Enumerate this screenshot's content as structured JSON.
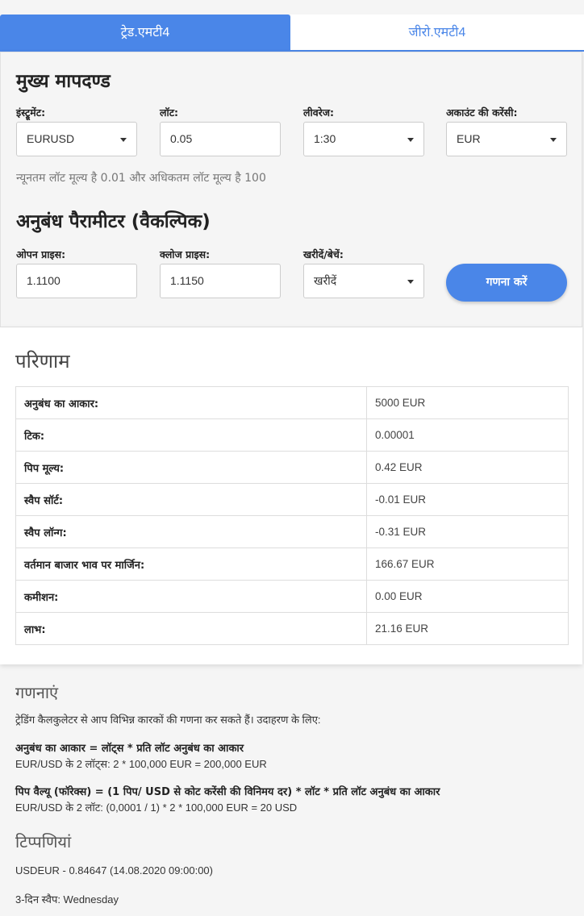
{
  "tabs": {
    "active": "ट्रेड.एमटी4",
    "inactive": "जीरो.एमटी4"
  },
  "main_params": {
    "title": "मुख्य मापदण्ड",
    "instrument": {
      "label": "इंस्ट्रूमेंट:",
      "value": "EURUSD"
    },
    "lot": {
      "label": "लॉट:",
      "value": "0.05"
    },
    "leverage": {
      "label": "लीवरेज:",
      "value": "1:30"
    },
    "currency": {
      "label": "अकाउंट की करेंसी:",
      "value": "EUR"
    },
    "hint": "न्यूनतम लॉट मूल्य है 0.01 और अधिकतम लॉट मूल्य है 100"
  },
  "contract_params": {
    "title": "अनुबंध पैरामीटर (वैकल्पिक)",
    "open_price": {
      "label": "ओपन प्राइस:",
      "value": "1.1100"
    },
    "close_price": {
      "label": "क्लोज प्राइस:",
      "value": "1.1150"
    },
    "buy_sell": {
      "label": "खरीदें/बेचें:",
      "value": "खरीदें"
    },
    "calculate_label": "गणना करें"
  },
  "results": {
    "title": "परिणाम",
    "rows": [
      {
        "key": "अनुबंध का आकार:",
        "value": "5000 EUR"
      },
      {
        "key": "टिक:",
        "value": "0.00001"
      },
      {
        "key": "पिप मूल्य:",
        "value": "0.42 EUR"
      },
      {
        "key": "स्वैप सॉर्ट:",
        "value": "-0.01 EUR"
      },
      {
        "key": "स्वैप लॉन्ग:",
        "value": "-0.31 EUR"
      },
      {
        "key": "वर्तमान बाजार भाव पर मार्जिन:",
        "value": "166.67 EUR"
      },
      {
        "key": "कमीशन:",
        "value": "0.00 EUR"
      },
      {
        "key": "लाभ:",
        "value": "21.16 EUR"
      }
    ]
  },
  "calculations": {
    "title": "गणनाएं",
    "intro": "ट्रेडिंग कैलकुलेटर से आप विभिन्न कारकों की गणना कर सकते हैं। उदाहरण के लिए:",
    "formula1": "अनुबंध का आकार = लॉट्स * प्रति लॉट अनुबंध का आकार",
    "example1": "EUR/USD के 2 लॉट्स: 2 * 100,000 EUR = 200,000 EUR",
    "formula2": "पिप वैल्यू (फॉरेक्स) = (1 पिप/ USD से कोट करेंसी की विनिमय दर) * लॉट * प्रति लॉट अनुबंध का आकार",
    "example2": "EUR/USD के 2 लॉट: (0,0001 / 1) * 2 * 100,000 EUR = 20 USD"
  },
  "notes": {
    "title": "टिप्पणियां",
    "rate": "USDEUR - 0.84647 (14.08.2020 09:00:00)",
    "swap_day": "3-दिन स्वैप: Wednesday"
  }
}
